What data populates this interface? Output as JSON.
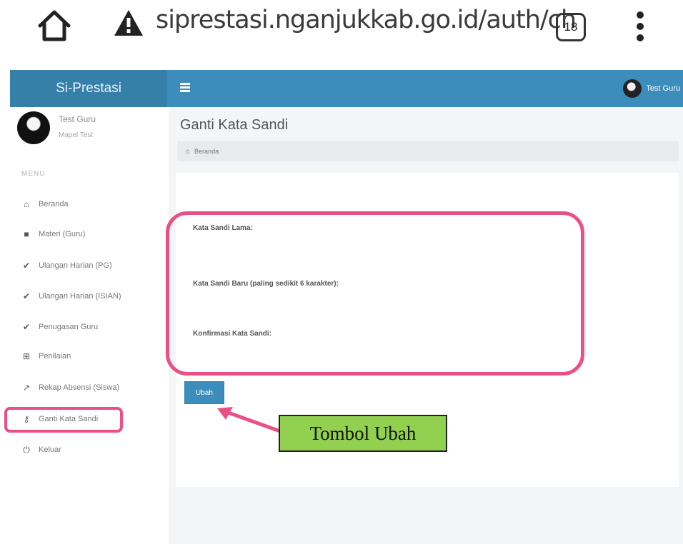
{
  "browser": {
    "url": "siprestasi.nganjukkab.go.id/auth/ch",
    "tab_count": "18",
    "icons": [
      "home-icon",
      "warning-icon",
      "tab-switcher-icon",
      "overflow-menu-icon"
    ]
  },
  "header": {
    "brand": "Si-Prestasi",
    "user_name": "Test Guru",
    "color": "#3c8dbc",
    "brand_color": "#367fa9"
  },
  "sidebar": {
    "user_name": "Test Guru",
    "user_subtitle": "Mapel Test",
    "menu_header": "MENU",
    "items": [
      {
        "label": "Beranda",
        "icon": "dashboard-icon",
        "glyph": "⌂"
      },
      {
        "label": "Materi (Guru)",
        "icon": "folder-icon",
        "glyph": "■"
      },
      {
        "label": "Ulangan Harian (PG)",
        "icon": "check-icon",
        "glyph": "✔"
      },
      {
        "label": "Ulangan Harian (ISIAN)",
        "icon": "check-icon",
        "glyph": "✔"
      },
      {
        "label": "Penugasan Guru",
        "icon": "check-icon",
        "glyph": "✔"
      },
      {
        "label": "Penilaian",
        "icon": "calculator-icon",
        "glyph": "⊞"
      },
      {
        "label": "Rekap Absensi (Siswa)",
        "icon": "line-chart-icon",
        "glyph": "↗"
      },
      {
        "label": "Ganti Kata Sandi",
        "icon": "key-icon",
        "glyph": "⚷"
      },
      {
        "label": "Keluar",
        "icon": "power-icon",
        "glyph": "⏻"
      }
    ],
    "active_item": "Ganti Kata Sandi",
    "highlight_color": "#ea4f86"
  },
  "main": {
    "page_title": "Ganti Kata Sandi",
    "breadcrumb": "Beranda",
    "form": {
      "fields": [
        {
          "label": "Kata Sandi Lama:",
          "value": ""
        },
        {
          "label": "Kata Sandi Baru (paling sedikit 6 karakter):",
          "value": ""
        },
        {
          "label": "Konfirmasi Kata Sandi:",
          "value": ""
        }
      ],
      "submit_label": "Ubah"
    }
  },
  "annotation": {
    "callout_text": "Tombol Ubah",
    "callout_color": "#92d050"
  }
}
